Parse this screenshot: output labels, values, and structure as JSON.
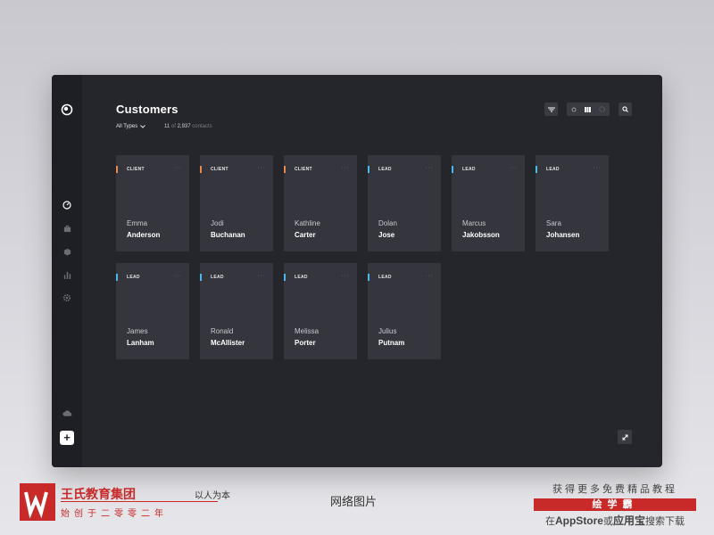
{
  "app": {
    "title": "Customers",
    "filter_label": "All Types",
    "count_shown": "11",
    "count_of": "of",
    "count_total": "2,937",
    "count_suffix": "contacts",
    "add_label": "+"
  },
  "colors": {
    "client_tag": "#e8894a",
    "lead_tag": "#4ab8e8",
    "background": "#25262c",
    "card": "#34353d"
  },
  "sidebar": {
    "items": [
      {
        "icon": "dashboard-icon"
      },
      {
        "icon": "briefcase-icon"
      },
      {
        "icon": "box-icon"
      },
      {
        "icon": "bar-chart-icon"
      },
      {
        "icon": "settings-icon"
      },
      {
        "icon": "cloud-icon"
      }
    ]
  },
  "toolbar": {
    "icons": [
      "filter-icon",
      "dot-view-icon",
      "grid-view-icon",
      "circle-view-icon",
      "search-icon"
    ]
  },
  "cards": [
    {
      "type": "CLIENT",
      "first": "Emma",
      "last": "Anderson",
      "more": "···"
    },
    {
      "type": "CLIENT",
      "first": "Jodi",
      "last": "Buchanan",
      "more": "···"
    },
    {
      "type": "CLIENT",
      "first": "Kathline",
      "last": "Carter",
      "more": "···"
    },
    {
      "type": "LEAD",
      "first": "Dolan",
      "last": "Jose",
      "more": "···"
    },
    {
      "type": "LEAD",
      "first": "Marcus",
      "last": "Jakobsson",
      "more": "···"
    },
    {
      "type": "LEAD",
      "first": "Sara",
      "last": "Johansen",
      "more": "···"
    },
    {
      "type": "LEAD",
      "first": "James",
      "last": "Lanham",
      "more": "···"
    },
    {
      "type": "LEAD",
      "first": "Ronald",
      "last": "McAllister",
      "more": "···"
    },
    {
      "type": "LEAD",
      "first": "Melissa",
      "last": "Porter",
      "more": "···"
    },
    {
      "type": "LEAD",
      "first": "Julius",
      "last": "Putnam",
      "more": "···"
    }
  ],
  "watermark": {
    "brand_name": "王氏教育集团",
    "slogan": "以人为本",
    "sub": "始创于二零零二年",
    "caption": "网络图片",
    "promo_line1": "获得更多免费精品教程",
    "promo_line2": "绘学霸",
    "promo_line3_a": "在",
    "promo_line3_b": "AppStore",
    "promo_line3_c": "或",
    "promo_line3_d": "应用宝",
    "promo_line3_e": "搜索下载"
  }
}
